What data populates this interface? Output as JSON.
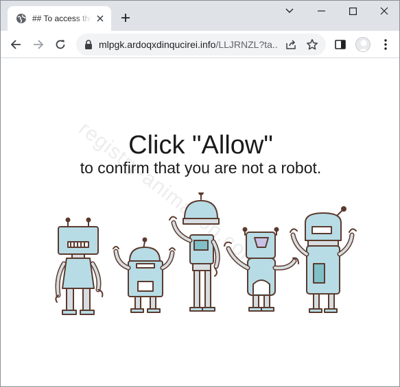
{
  "browser": {
    "tab": {
      "title": "## To access the"
    },
    "new_tab_label": "+",
    "url": {
      "host": "mlpgk.ardoqxdinqucirei.info",
      "path": "/LLJRNZL?ta..."
    }
  },
  "page": {
    "headline": "Click \"Allow\"",
    "subline": "to confirm that you are not a robot.",
    "watermark": "registry-animation.com",
    "illustration": "robots-illustration"
  },
  "colors": {
    "tabstrip": "#dfe3e8",
    "robot_fill": "#b7dce6",
    "robot_outline": "#5b3a2e"
  }
}
